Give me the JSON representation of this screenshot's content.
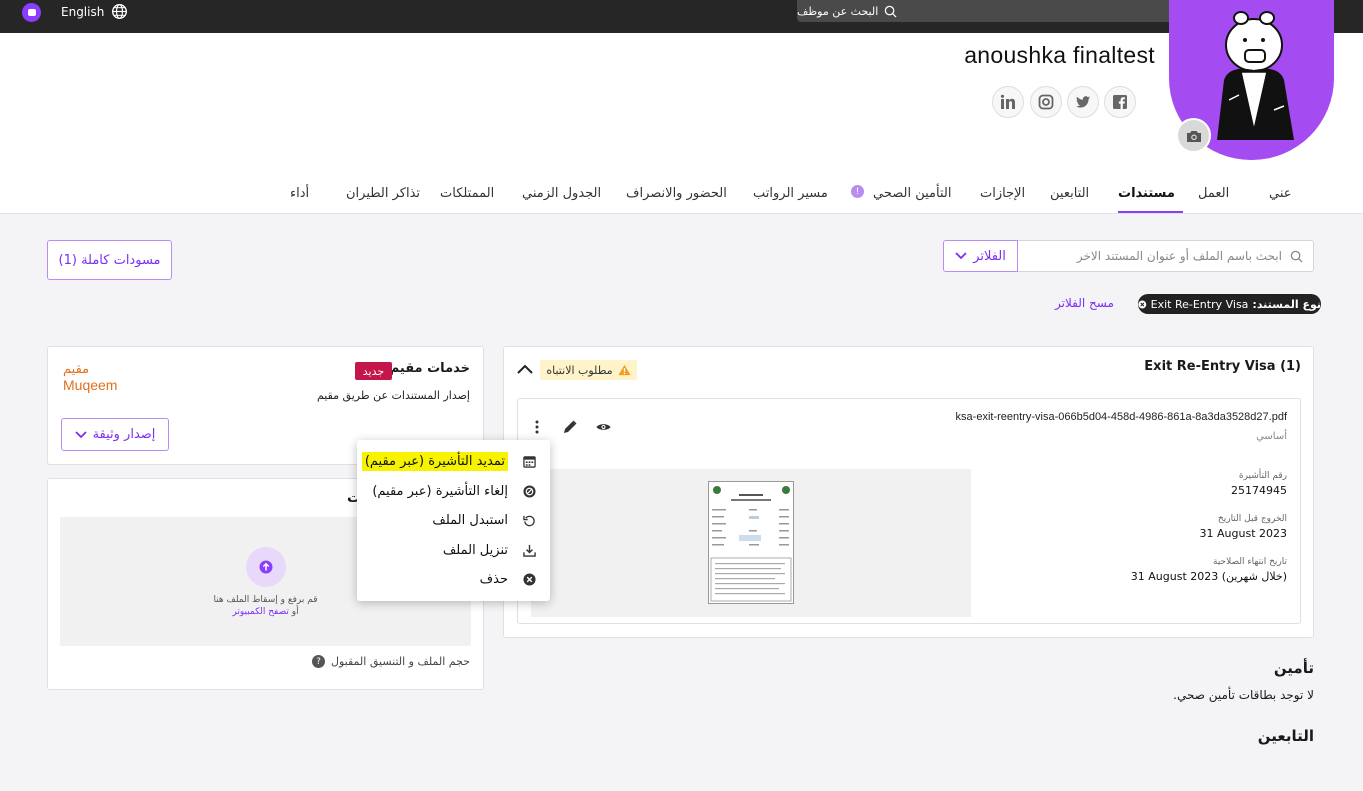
{
  "topbar": {
    "language": "English",
    "search_placeholder": "البحث عن موظف"
  },
  "profile": {
    "name": "anoushka finaltest",
    "social": [
      "linkedin-icon",
      "instagram-icon",
      "twitter-icon",
      "facebook-icon"
    ]
  },
  "tabs": [
    {
      "label": "عني"
    },
    {
      "label": "العمل"
    },
    {
      "label": "مستندات",
      "active": true
    },
    {
      "label": "التابعين"
    },
    {
      "label": "الإجازات"
    },
    {
      "label": "التأمين الصحي"
    },
    {
      "label": "مسير الرواتب"
    },
    {
      "label": "الحضور والانصراف"
    },
    {
      "label": "الجدول الزمني"
    },
    {
      "label": "الممتلكات"
    },
    {
      "label": "تذاكر الطيران"
    },
    {
      "label": "أداء"
    }
  ],
  "toolbar": {
    "drafts_label": "مسودات كاملة (1)",
    "doc_search_placeholder": "ابحث باسم الملف أو عنوان المستند الاخر",
    "filters_label": "الفلاتر",
    "chip_key": "نوع المستند:",
    "chip_value": "Exit Re-Entry Visa",
    "clear_filters": "مسح الفلاتر"
  },
  "document_group": {
    "title": "Exit Re-Entry Visa (1)",
    "attention": "مطلوب الانتباه",
    "file": {
      "name": "ksa-exit-reentry-visa-066b5d04-458d-4986-861a-8a3da3528d27.pdf",
      "type": "أساسي",
      "fields": [
        {
          "label": "رقم التأشيرة",
          "value": "25174945"
        },
        {
          "label": "الخروج قبل التاريخ",
          "value": "31 August 2023"
        },
        {
          "label": "تاريخ انتهاء الصلاحية",
          "value": "31 August 2023 (خلال شهرين)"
        }
      ]
    }
  },
  "muqeem": {
    "title": "خدمات مقيم",
    "badge": "جديد",
    "subtitle": "إصدار المستندات عن طريق مقيم",
    "logo_ar": "مقيم",
    "logo_en": "Muqeem",
    "issue_label": "إصدار وثيقة"
  },
  "upload": {
    "heading_fragment": "ت",
    "line1": "قم برفع و إسقاط الملف هنا",
    "or": "أو",
    "browse": "تصفح الكمبيوتر",
    "size_hint": "حجم الملف و التنسيق المقبول",
    "help": "?"
  },
  "context_menu": [
    {
      "label": "تمديد التأشيرة (عبر مقيم)",
      "icon": "calendar-icon",
      "highlighted": true
    },
    {
      "label": "إلغاء التأشيرة (عبر مقيم)",
      "icon": "cancel-circle-icon"
    },
    {
      "label": "استبدل الملف",
      "icon": "replace-icon"
    },
    {
      "label": "تنزيل الملف",
      "icon": "download-icon"
    },
    {
      "label": "حذف",
      "icon": "delete-icon"
    }
  ],
  "insurance": {
    "heading": "تأمين",
    "empty": "لا توجد بطاقات تأمين صحي."
  },
  "dependents": {
    "heading": "التابعين"
  },
  "colors": {
    "accent": "#7b2ff7",
    "topbar": "#262626",
    "avatar_bg": "#a44cf2",
    "badge": "#c4164a",
    "highlight": "#f6f200",
    "attention_bg": "#fff3c9"
  }
}
